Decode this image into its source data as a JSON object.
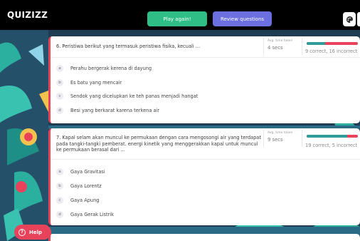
{
  "header": {
    "logo": "QUIZIZZ",
    "play_again": "Play again!",
    "review_questions": "Review questions",
    "palette_icon": "palette-icon"
  },
  "questions": [
    {
      "text": "6. Peristiwa berikut yang termasuk peristiwa fisika, kecuali ...",
      "time_label": "Avg. time taken",
      "time_value": "4 secs",
      "result": "9 correct, 16 incorrect",
      "correct_fraction": 0.36,
      "options": [
        {
          "letter": "a",
          "text": "Perahu bergerak kerena di dayung"
        },
        {
          "letter": "b",
          "text": "Es batu yang mencair"
        },
        {
          "letter": "c",
          "text": "Sendok yang dicelupkan ke teh panas menjadi hangat"
        },
        {
          "letter": "d",
          "text": "Besi yang berkarat karena terkena air"
        }
      ]
    },
    {
      "text_lines": [
        "7. Kapal selam akan muncul ke permukaan dengan cara mengosongi air yang terdapat",
        "pada tangki-tangki pemberat. energi kinetik yang menggerakkan kapal untuk muncul",
        "ke permukaan berasal dari ..."
      ],
      "time_label": "Avg. time taken",
      "time_value": "9 secs",
      "result": "19 correct, 5 incorrect",
      "correct_fraction": 0.79,
      "options": [
        {
          "letter": "a",
          "text": "Gaya Gravitasi"
        },
        {
          "letter": "b",
          "text": "Gaya Lorentz"
        },
        {
          "letter": "c",
          "text": "Gaya Apung"
        },
        {
          "letter": "d",
          "text": "Gaya Gerak Listrik"
        }
      ]
    }
  ],
  "help": {
    "label": "Help",
    "icon_glyph": "?"
  },
  "colors": {
    "correct": "#2e9c9a",
    "incorrect": "#e8435b",
    "play_again": "#2fbf86",
    "review": "#6c6fe0",
    "background": "#1f3d52"
  }
}
